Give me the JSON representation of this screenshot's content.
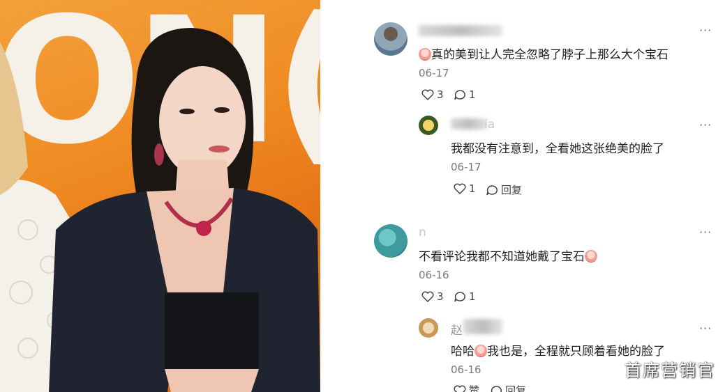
{
  "colors": {
    "accent": "#ef8a22",
    "text": "#1f1f1f",
    "muted": "#7a7a7a"
  },
  "photo": {
    "backdrop_text": "ON(",
    "description_icon": "celebrity-photo"
  },
  "comments": [
    {
      "username": "",
      "text": "真的美到让人完全忽略了脖子上那么大个宝石",
      "date": "06-17",
      "likes": "3",
      "replies": "1",
      "reply": {
        "username": "ia",
        "text": "我都没有注意到，全看她这张绝美的脸了",
        "date": "06-17",
        "likes": "1",
        "reply_label": "回复"
      }
    },
    {
      "username": "n",
      "text": "不看评论我都不知道她戴了宝石",
      "date": "06-16",
      "likes": "3",
      "replies": "1",
      "reply": {
        "username": "赵",
        "text_prefix": "哈哈",
        "text": "我也是，全程就只顾着看她的脸了",
        "date": "06-16",
        "likes": "赞",
        "reply_label": "回复"
      }
    }
  ],
  "more_label": "···",
  "watermark": "首席营销官"
}
